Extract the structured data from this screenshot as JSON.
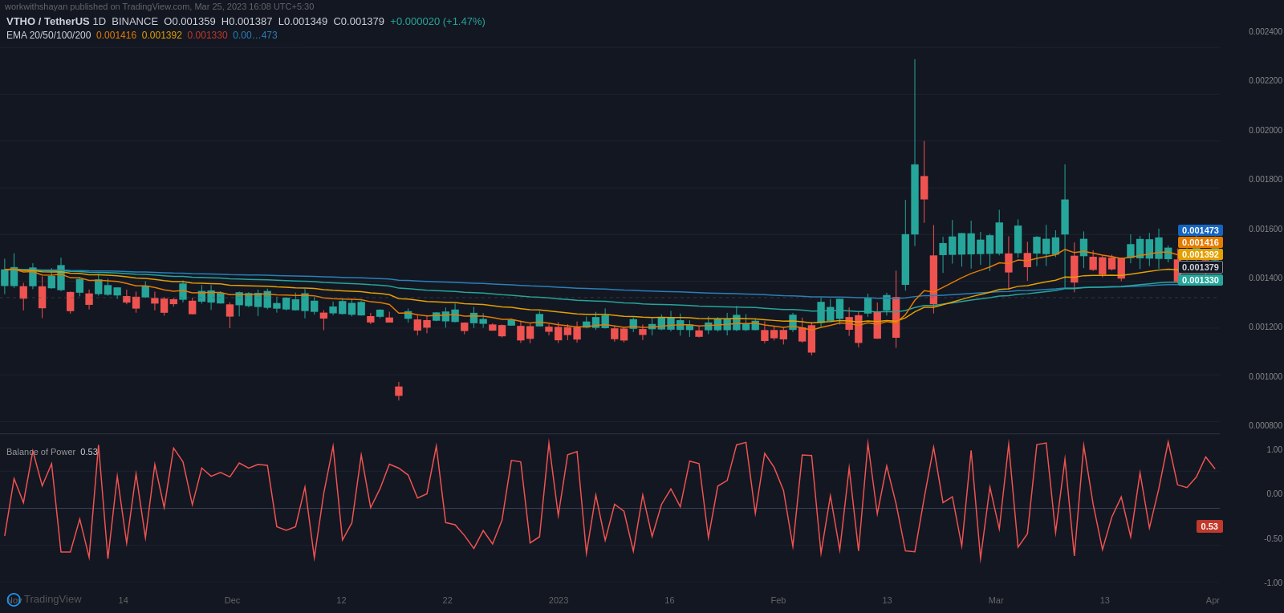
{
  "watermark": "workwithshayan published on TradingView.com, Mar 25, 2023 16:08 UTC+5:30",
  "symbol": {
    "pair": "VTHO / TetherUS",
    "timeframe": "1D",
    "exchange": "BINANCE",
    "open": "0.001359",
    "high": "0.001387",
    "low": "0.001349",
    "close": "0.001379",
    "change": "+0.000020 (+1.47%)"
  },
  "ema": {
    "label": "EMA 20/50/100/200",
    "val20": "0.001416",
    "val50": "0.001392",
    "val100": "0.001330",
    "val200": "0.00…473"
  },
  "ema_labels": {
    "lbl200": "0.001473",
    "lbl20": "0.001416",
    "lbl50": "0.001392",
    "close": "0.001379",
    "lbl100": "0.001330"
  },
  "y_axis_main": [
    "0.002400",
    "0.002200",
    "0.002000",
    "0.001800",
    "0.001600",
    "0.001400",
    "0.001200",
    "0.001000",
    "0.000800"
  ],
  "y_axis_bop": [
    "1.00",
    "0.00",
    "-0.50",
    "-1.00"
  ],
  "bop": {
    "label": "Balance of Power",
    "value": "0.53"
  },
  "bop_right_label": "0.53",
  "x_axis": [
    "Nov",
    "14",
    "Dec",
    "12",
    "22",
    "2023",
    "16",
    "Feb",
    "13",
    "Mar",
    "13",
    "Apr"
  ],
  "colors": {
    "background": "#131722",
    "grid": "#1e2330",
    "bull": "#26a69a",
    "bear": "#ef5350",
    "ema20": "#e57c00",
    "ema50": "#e5a000",
    "ema100": "#c0392b",
    "ema200": "#2980b9",
    "bop_line": "#ef5350"
  },
  "logo": "TradingView"
}
